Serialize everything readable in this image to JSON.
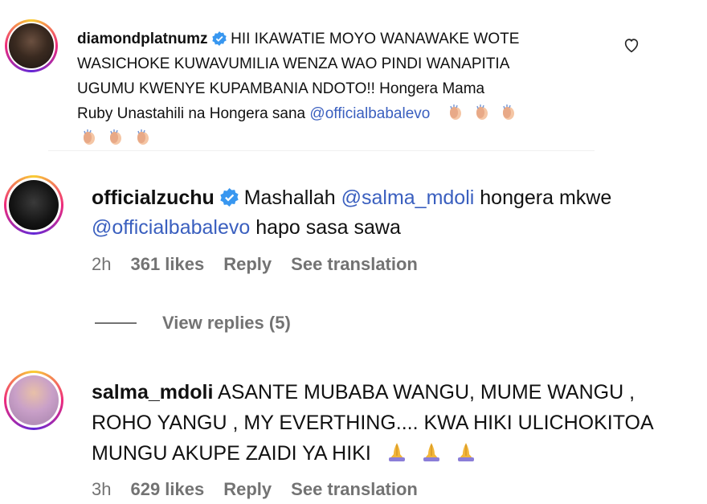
{
  "comment1": {
    "username": "diamondplatnumz",
    "text_line1": "HII IKAWATIE MOYO WANAWAKE WOTE",
    "text_line2": "WASICHOKE KUWAVUMILIA WENZA WAO PINDI WANAPITIA",
    "text_line3": "UGUMU KWENYE KUPAMBANIA NDOTO!! Hongera Mama",
    "text_line4_a": "Ruby Unastahili na Hongera sana ",
    "mention": "@officialbabalevo",
    "emoji": "clapping-hands"
  },
  "comment2": {
    "username": "officialzuchu",
    "text_a": "Mashallah ",
    "mention1": "@salma_mdoli",
    "text_b": " hongera mkwe",
    "mention2": "@officialbabalevo",
    "text_c": " hapo sasa sawa",
    "time": "2h",
    "likes": "361 likes",
    "reply": "Reply",
    "translate": "See translation",
    "view_replies": "View replies (5)"
  },
  "comment3": {
    "username": "salma_mdoli",
    "text_line1": "ASANTE MUBABA WANGU, MUME WANGU ,",
    "text_line2": "ROHO YANGU , MY EVERTHING.... KWA HIKI ULICHOKITOA",
    "text_line3": "MUNGU AKUPE ZAIDI YA HIKI",
    "emoji": "folded-hands",
    "time": "3h",
    "likes": "629 likes",
    "reply": "Reply",
    "translate": "See translation"
  },
  "colors": {
    "mention": "#3a5fbf",
    "meta": "#737373",
    "verified": "#3897f0"
  }
}
